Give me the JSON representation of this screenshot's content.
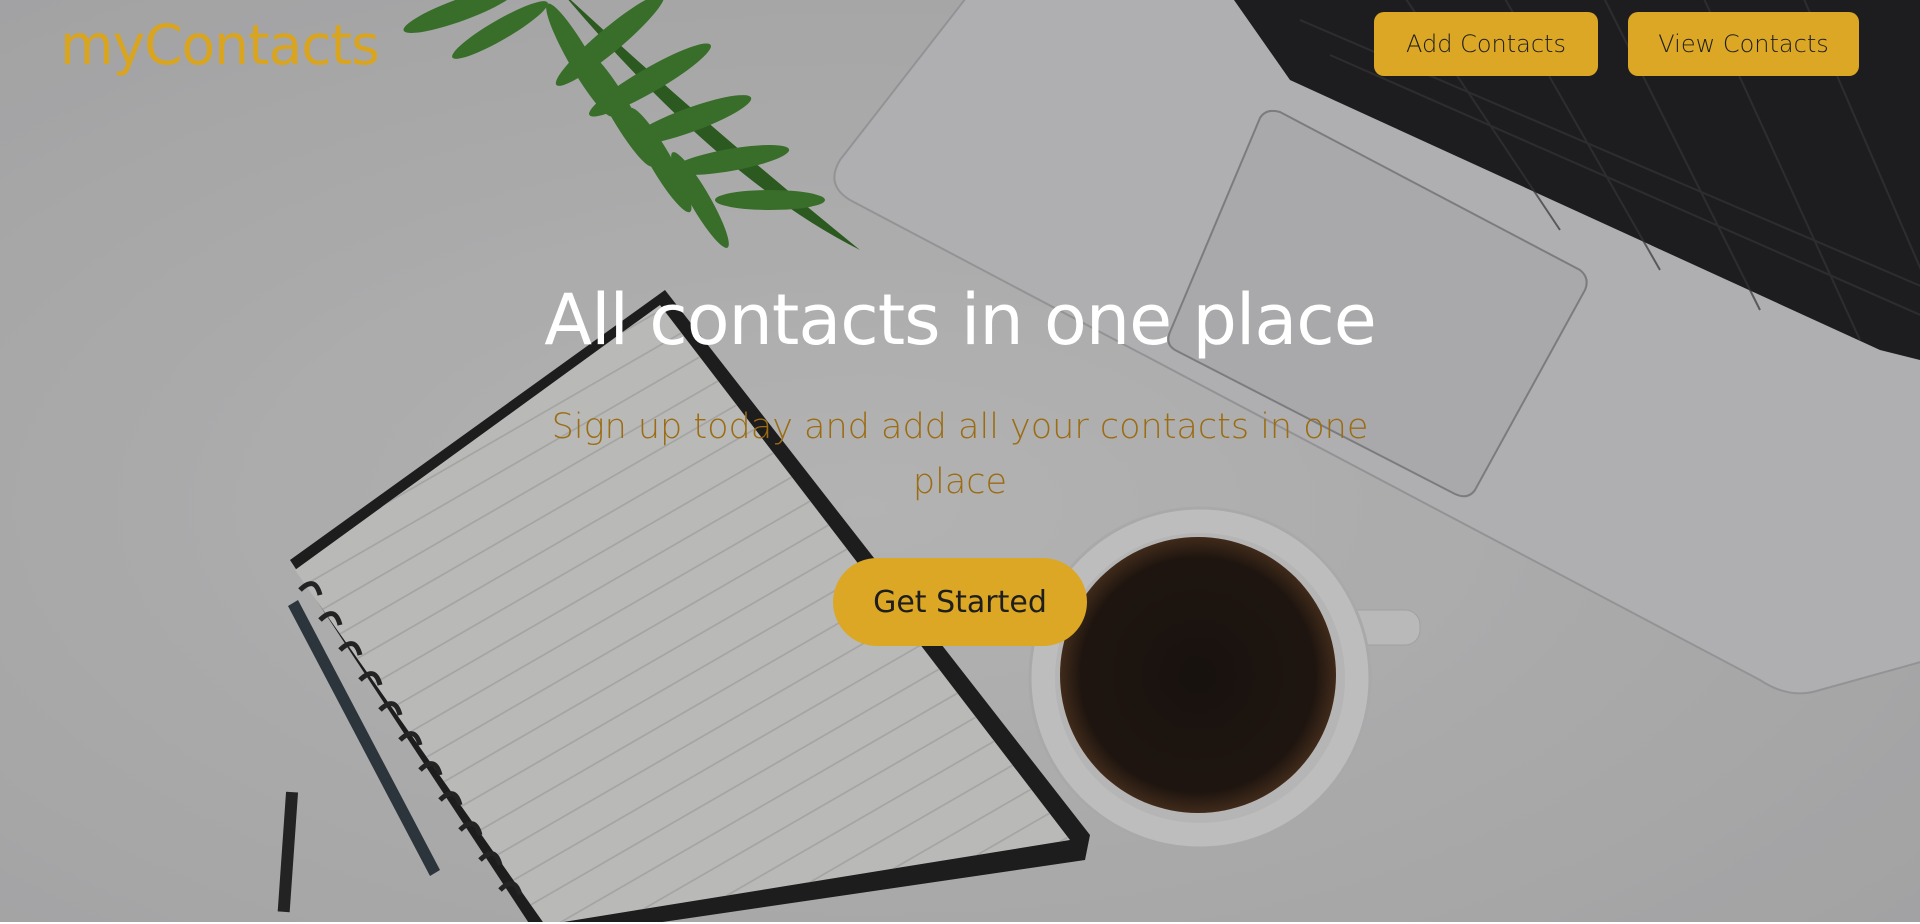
{
  "brand": {
    "logo_text": "myContacts",
    "accent_color": "#dba724"
  },
  "nav": {
    "add_contacts_label": "Add Contacts",
    "view_contacts_label": "View Contacts"
  },
  "hero": {
    "title": "All contacts in one place",
    "subtitle": "Sign up today and add all your contacts in one place",
    "cta_label": "Get Started",
    "background_image": "desk-photo-laptop-notebook-coffee"
  }
}
